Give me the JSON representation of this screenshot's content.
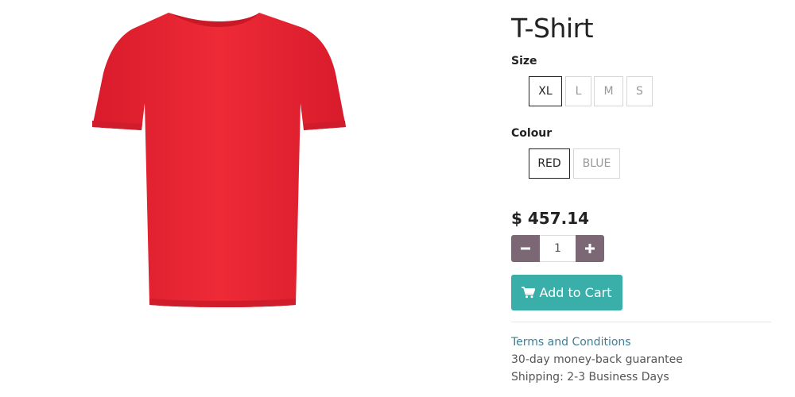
{
  "product": {
    "title": "T-Shirt",
    "image_icon": "red-tshirt-image"
  },
  "attributes": {
    "size": {
      "label": "Size",
      "options": [
        "XL",
        "L",
        "M",
        "S"
      ],
      "selected": "XL"
    },
    "colour": {
      "label": "Colour",
      "options": [
        "RED",
        "BLUE"
      ],
      "selected": "RED"
    }
  },
  "price": "$ 457.14",
  "quantity": {
    "value": "1",
    "minus_icon": "minus-icon",
    "plus_icon": "plus-icon"
  },
  "cart": {
    "label": "Add to Cart",
    "icon": "shopping-cart-icon"
  },
  "footer": {
    "terms_link": "Terms and Conditions",
    "guarantee": "30-day money-back guarantee",
    "shipping": "Shipping: 2-3 Business Days"
  },
  "colors": {
    "accent": "#3aafa9",
    "qty_button": "#7c6874",
    "link": "#3d7f96",
    "product_red": "#e8232f"
  }
}
